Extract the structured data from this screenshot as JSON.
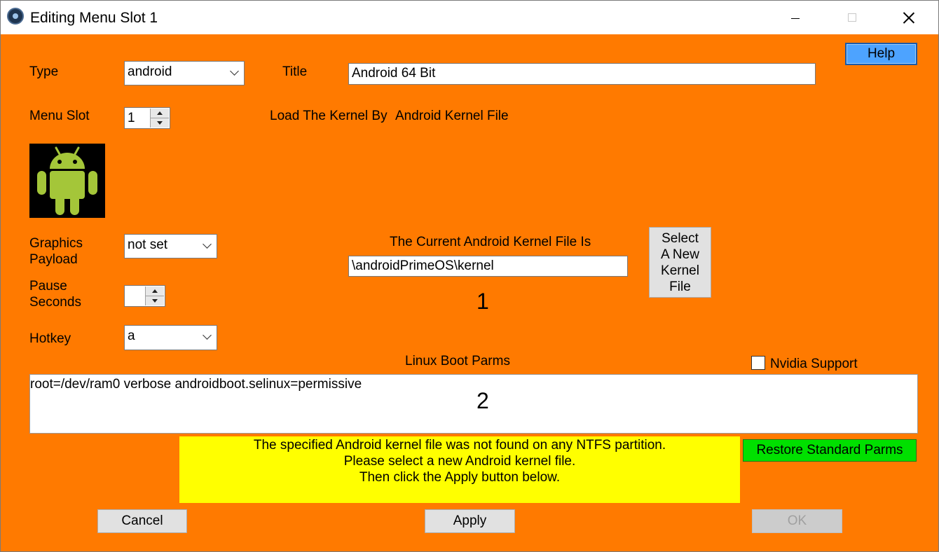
{
  "window": {
    "title": "Editing Menu Slot 1",
    "icon": "app-icon",
    "controls": [
      "minimize-icon",
      "maximize-icon",
      "close-icon"
    ]
  },
  "form": {
    "type_label": "Type",
    "type_value": "android",
    "title_label": "Title",
    "title_value": "Android 64 Bit",
    "help_label": "Help",
    "menu_slot_label": "Menu Slot",
    "menu_slot_value": "1",
    "load_kernel_label": "Load The Kernel By",
    "load_kernel_value": "Android Kernel File",
    "os_icon": "android-icon",
    "graphics_label_line1": "Graphics",
    "graphics_label_line2": "Payload",
    "graphics_value": "not set",
    "pause_label_line1": "Pause",
    "pause_label_line2": "Seconds",
    "pause_value": "",
    "hotkey_label": "Hotkey",
    "hotkey_value": "a",
    "current_kernel_label": "The Current Android Kernel File Is",
    "current_kernel_value": "\\androidPrimeOS\\kernel",
    "select_kernel_line1": "Select",
    "select_kernel_line2": "A New",
    "select_kernel_line3": "Kernel",
    "select_kernel_line4": "File",
    "marker_1": "1",
    "boot_parms_label": "Linux Boot Parms",
    "nvidia_label": "Nvidia Support",
    "nvidia_checked": false,
    "boot_parms_value": "root=/dev/ram0 verbose androidboot.selinux=permissive",
    "marker_2": "2",
    "restore_label": "Restore Standard Parms",
    "warning_line1": "The specified Android kernel file was not found on any NTFS partition.",
    "warning_line2": "Please select a new Android kernel file.",
    "warning_line3": "Then click the Apply button below."
  },
  "footer": {
    "cancel_label": "Cancel",
    "apply_label": "Apply",
    "ok_label": "OK"
  },
  "colors": {
    "window_background": "#ff7a00",
    "warning_background": "#ffff00",
    "restore_button": "#00e000",
    "help_button": "#4da3ff",
    "android_green": "#a4c639"
  }
}
